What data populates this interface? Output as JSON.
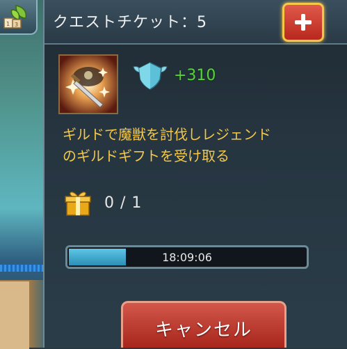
{
  "header": {
    "title": "クエストチケット：5",
    "add_button_icon": "plus-icon"
  },
  "quest": {
    "icon": "quest-sword-explosion-icon",
    "reward": {
      "icon": "guild-shield-wings-icon",
      "value": "+310"
    },
    "description_line1": "ギルドで魔獣を討伐しレジェンド",
    "description_line2": "のギルドギフトを受け取る",
    "progress_icon": "gift-box-icon",
    "progress_count": "0 / 1"
  },
  "timer": {
    "text": "18:09:06",
    "fill_fraction": 0.25
  },
  "actions": {
    "cancel_label": "キャンセル"
  },
  "colors": {
    "title_text": "#f0f0f0",
    "description_text": "#f3c74a",
    "reward_text": "#57d13a",
    "cancel_button": "#c0392b",
    "add_button": "#d0392b",
    "add_button_border": "#f5c84a",
    "progress_fill": "#3aa6cf"
  }
}
